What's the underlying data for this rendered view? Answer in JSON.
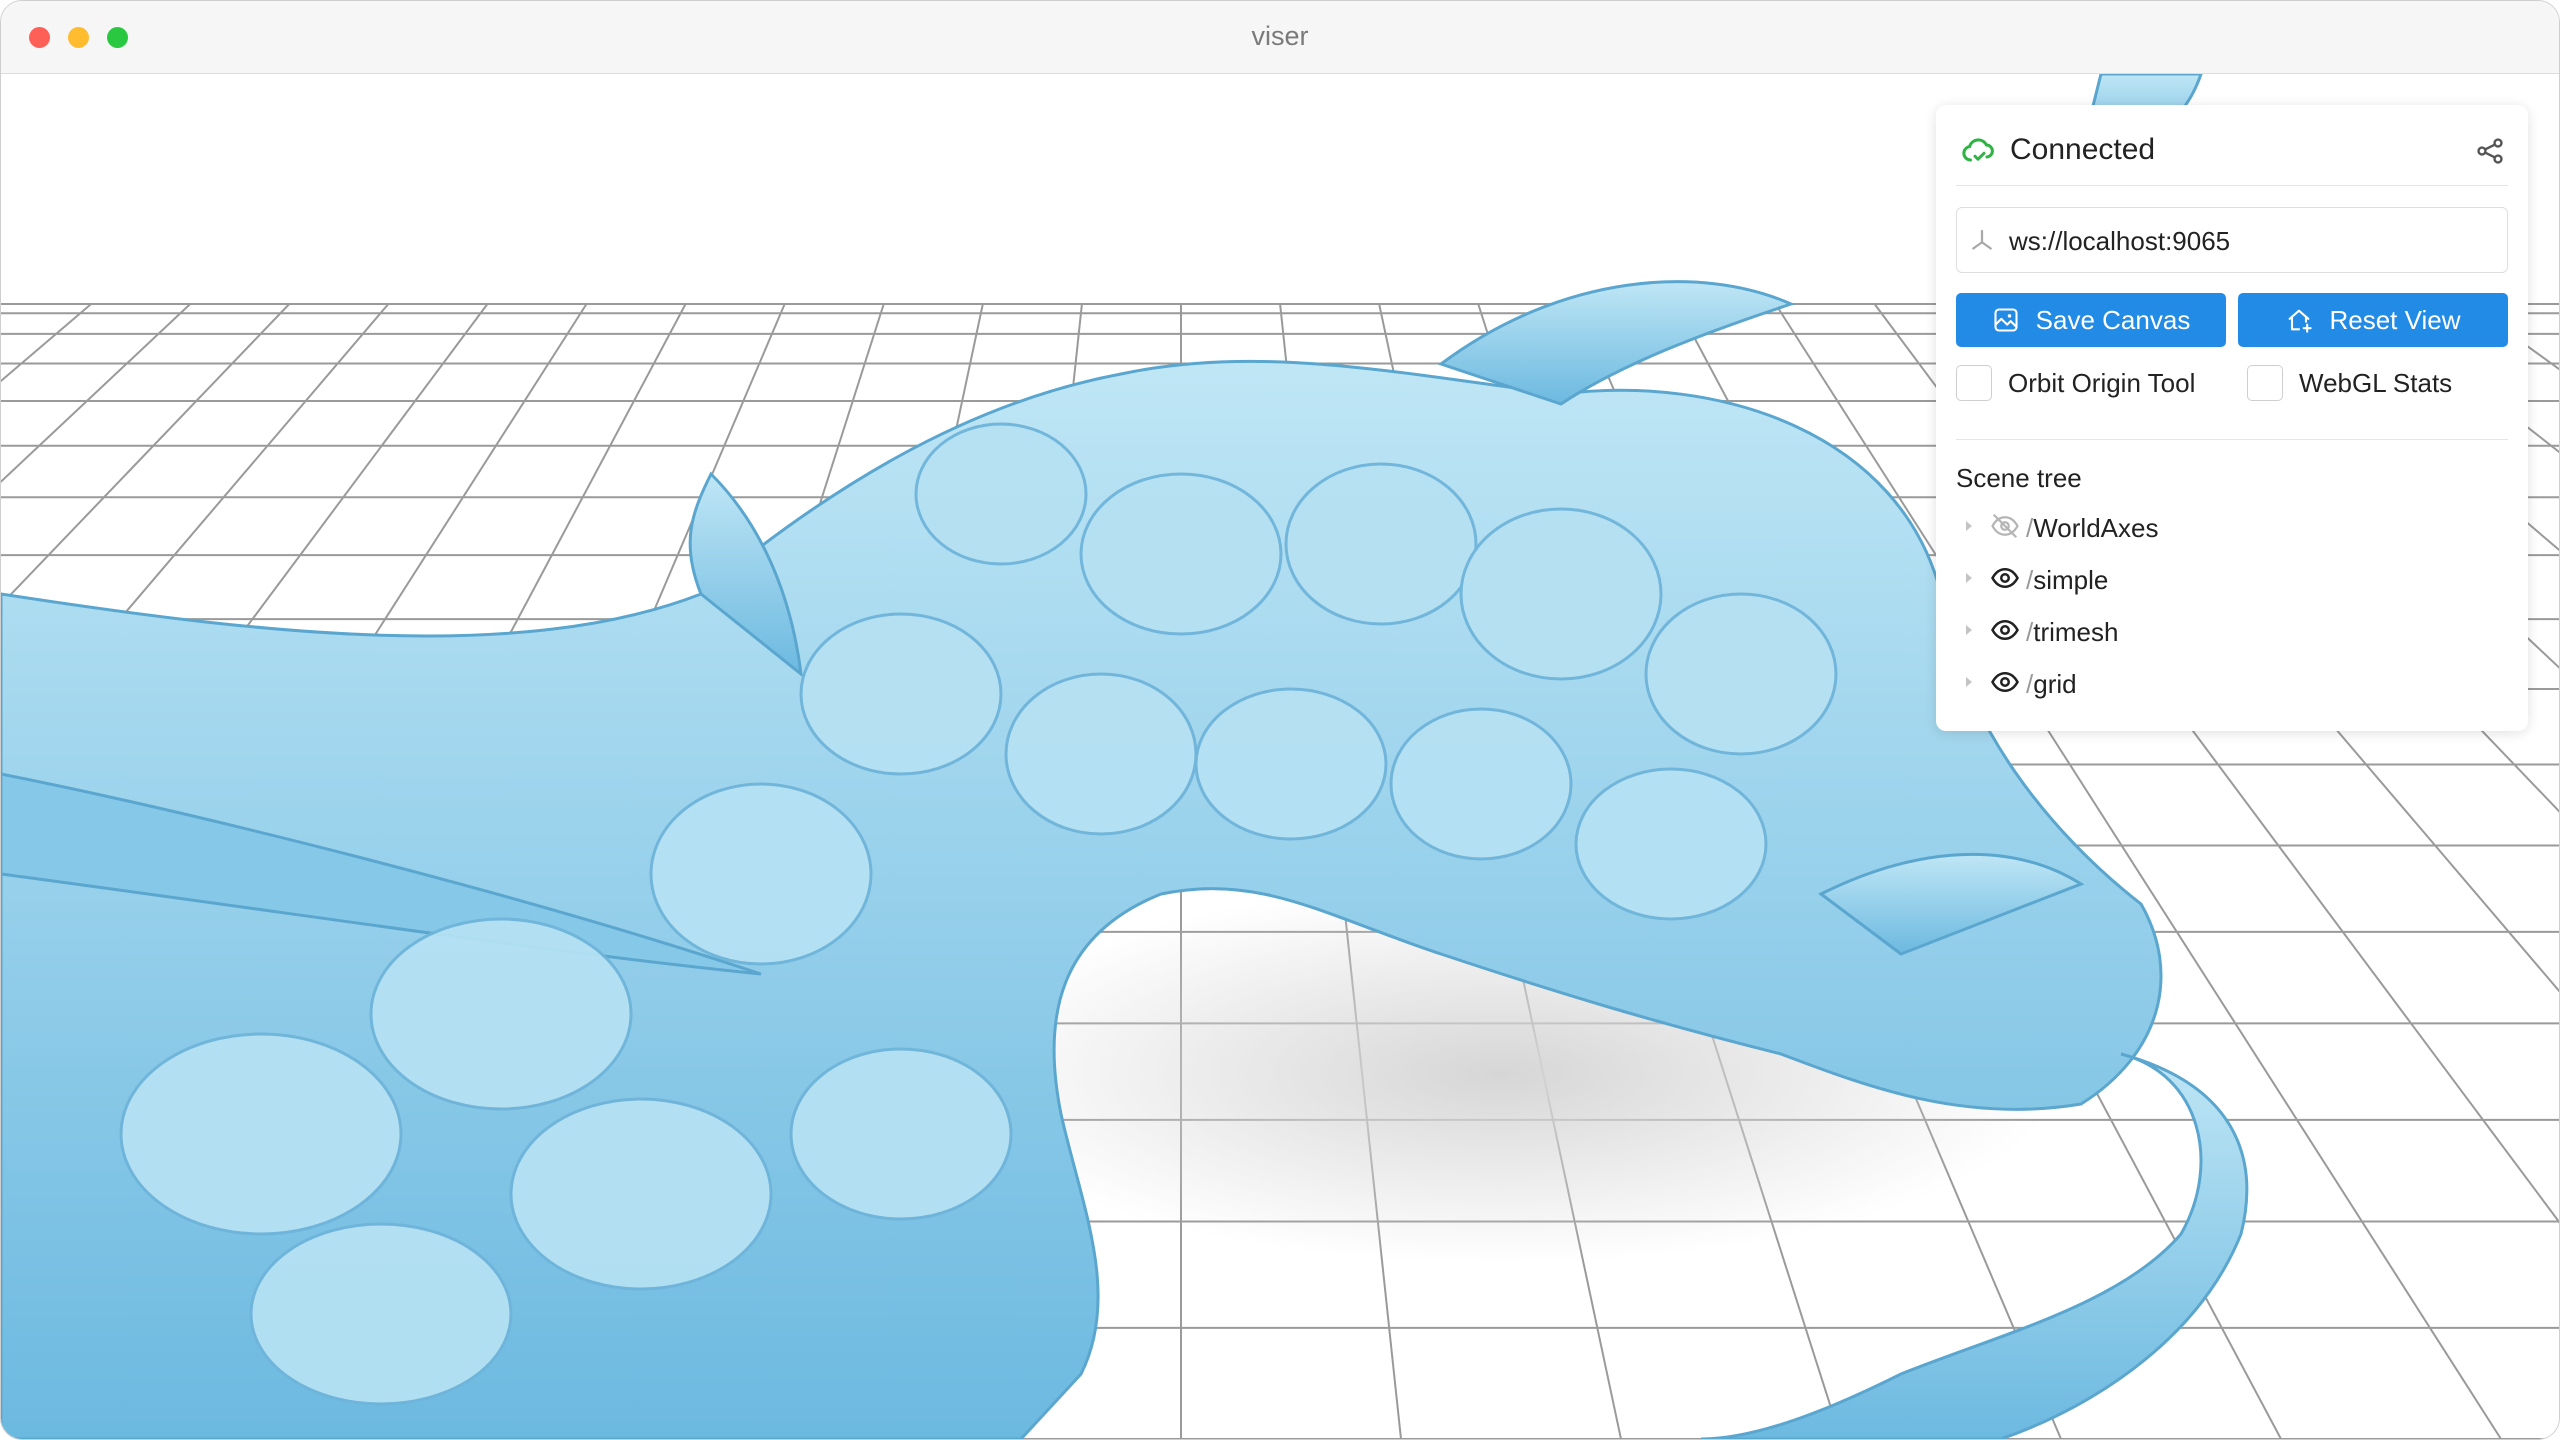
{
  "window": {
    "title": "viser"
  },
  "panel": {
    "connection_status": "Connected",
    "server_url": "ws://localhost:9065",
    "save_canvas_label": "Save Canvas",
    "reset_view_label": "Reset View",
    "orbit_origin_label": "Orbit Origin Tool",
    "orbit_origin_checked": false,
    "webgl_stats_label": "WebGL Stats",
    "webgl_stats_checked": false,
    "scene_tree_title": "Scene tree",
    "scene_tree": [
      {
        "slash": "/",
        "name": "WorldAxes",
        "visible": false
      },
      {
        "slash": "/",
        "name": "simple",
        "visible": true
      },
      {
        "slash": "/",
        "name": "trimesh",
        "visible": true
      },
      {
        "slash": "/",
        "name": "grid",
        "visible": true
      }
    ]
  },
  "colors": {
    "accent": "#228be6",
    "connected": "#2fb344",
    "mesh": "#a8dcef"
  }
}
